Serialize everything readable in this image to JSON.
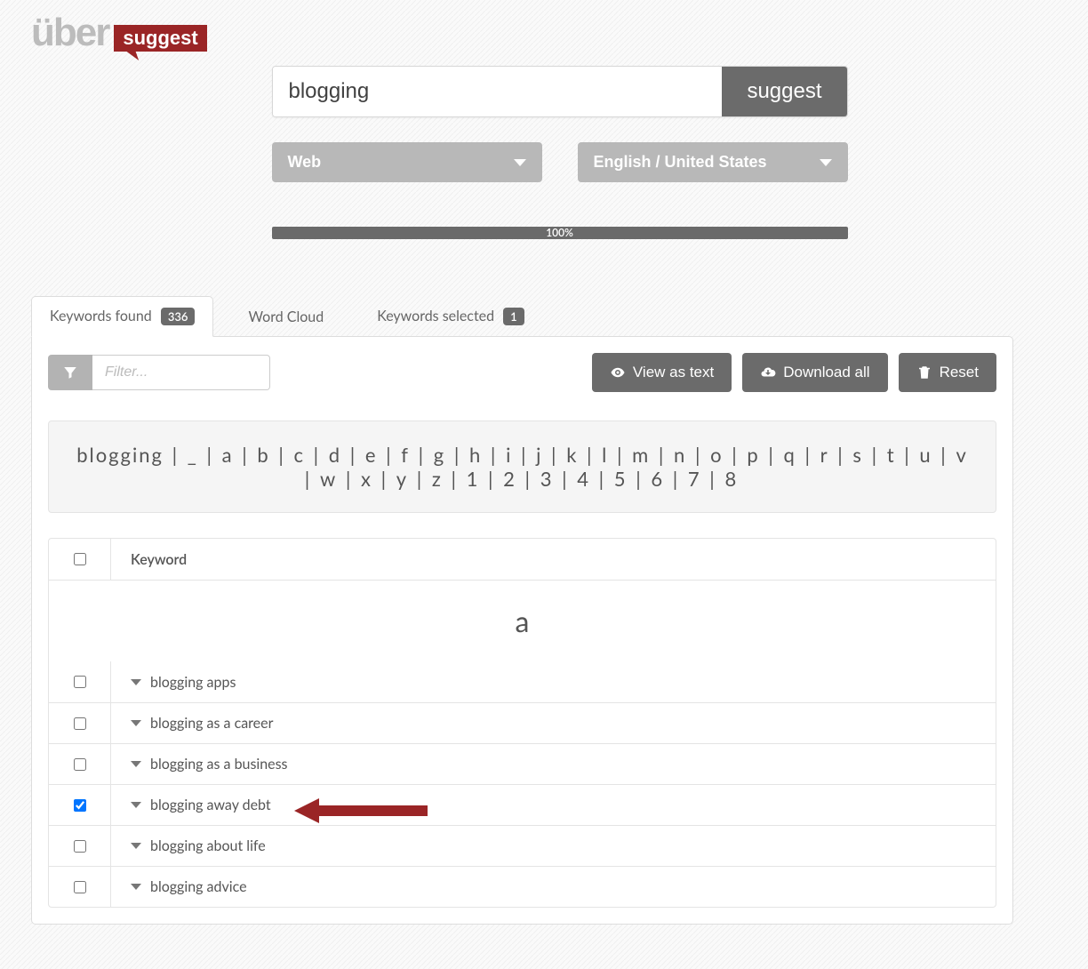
{
  "logo": {
    "prefix": "über",
    "suffix": "suggest"
  },
  "search": {
    "query": "blogging",
    "button": "suggest",
    "source_select": "Web",
    "locale_select": "English / United States",
    "progress": "100%"
  },
  "tabs": {
    "keywords_found": {
      "label": "Keywords found",
      "count": "336"
    },
    "word_cloud": {
      "label": "Word Cloud"
    },
    "keywords_selected": {
      "label": "Keywords selected",
      "count": "1"
    }
  },
  "toolbar": {
    "filter_placeholder": "Filter...",
    "view_as_text": "View as text",
    "download_all": "Download all",
    "reset": "Reset"
  },
  "alpha": {
    "root": "blogging",
    "items": [
      "_",
      "a",
      "b",
      "c",
      "d",
      "e",
      "f",
      "g",
      "h",
      "i",
      "j",
      "k",
      "l",
      "m",
      "n",
      "o",
      "p",
      "q",
      "r",
      "s",
      "t",
      "u",
      "v",
      "w",
      "x",
      "y",
      "z",
      "1",
      "2",
      "3",
      "4",
      "5",
      "6",
      "7",
      "8"
    ]
  },
  "table": {
    "header_keyword": "Keyword",
    "section_letter": "a",
    "rows": [
      {
        "kw": "blogging apps",
        "checked": false
      },
      {
        "kw": "blogging as a career",
        "checked": false
      },
      {
        "kw": "blogging as a business",
        "checked": false
      },
      {
        "kw": "blogging away debt",
        "checked": true
      },
      {
        "kw": "blogging about life",
        "checked": false
      },
      {
        "kw": "blogging advice",
        "checked": false
      }
    ]
  }
}
